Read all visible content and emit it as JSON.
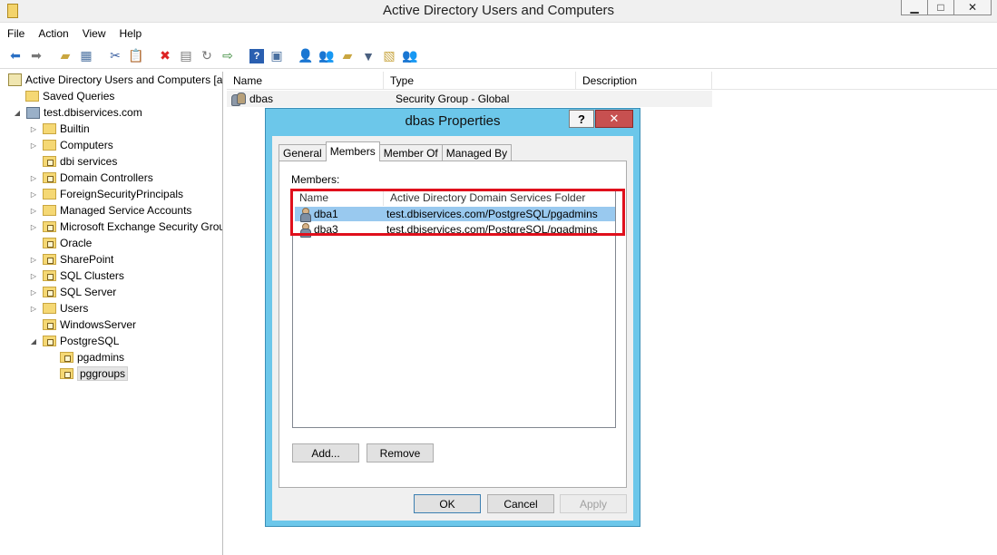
{
  "window": {
    "title": "Active Directory Users and Computers"
  },
  "menu": [
    "File",
    "Action",
    "View",
    "Help"
  ],
  "tree": {
    "root": "Active Directory Users and Computers [a",
    "saved_queries": "Saved Queries",
    "domain": "test.dbiservices.com",
    "items": [
      "Builtin",
      "Computers",
      "dbi services",
      "Domain Controllers",
      "ForeignSecurityPrincipals",
      "Managed Service Accounts",
      "Microsoft Exchange Security Grou",
      "Oracle",
      "SharePoint",
      "SQL Clusters",
      "SQL Server",
      "Users",
      "WindowsServer",
      "PostgreSQL"
    ],
    "children": [
      "pgadmins",
      "pggroups"
    ]
  },
  "list": {
    "columns": [
      "Name",
      "Type",
      "Description"
    ],
    "rows": [
      {
        "name": "dbas",
        "type": "Security Group - Global",
        "description": ""
      }
    ]
  },
  "dialog": {
    "title": "dbas Properties",
    "help": "?",
    "close": "✕",
    "tabs": [
      "General",
      "Members",
      "Member Of",
      "Managed By"
    ],
    "members_label": "Members:",
    "columns": [
      "Name",
      "Active Directory Domain Services Folder"
    ],
    "members": [
      {
        "name": "dba1",
        "folder": "test.dbiservices.com/PostgreSQL/pgadmins"
      },
      {
        "name": "dba3",
        "folder": "test.dbiservices.com/PostgreSQL/pgadmins"
      }
    ],
    "add": "Add...",
    "remove": "Remove",
    "ok": "OK",
    "cancel": "Cancel",
    "apply": "Apply"
  }
}
